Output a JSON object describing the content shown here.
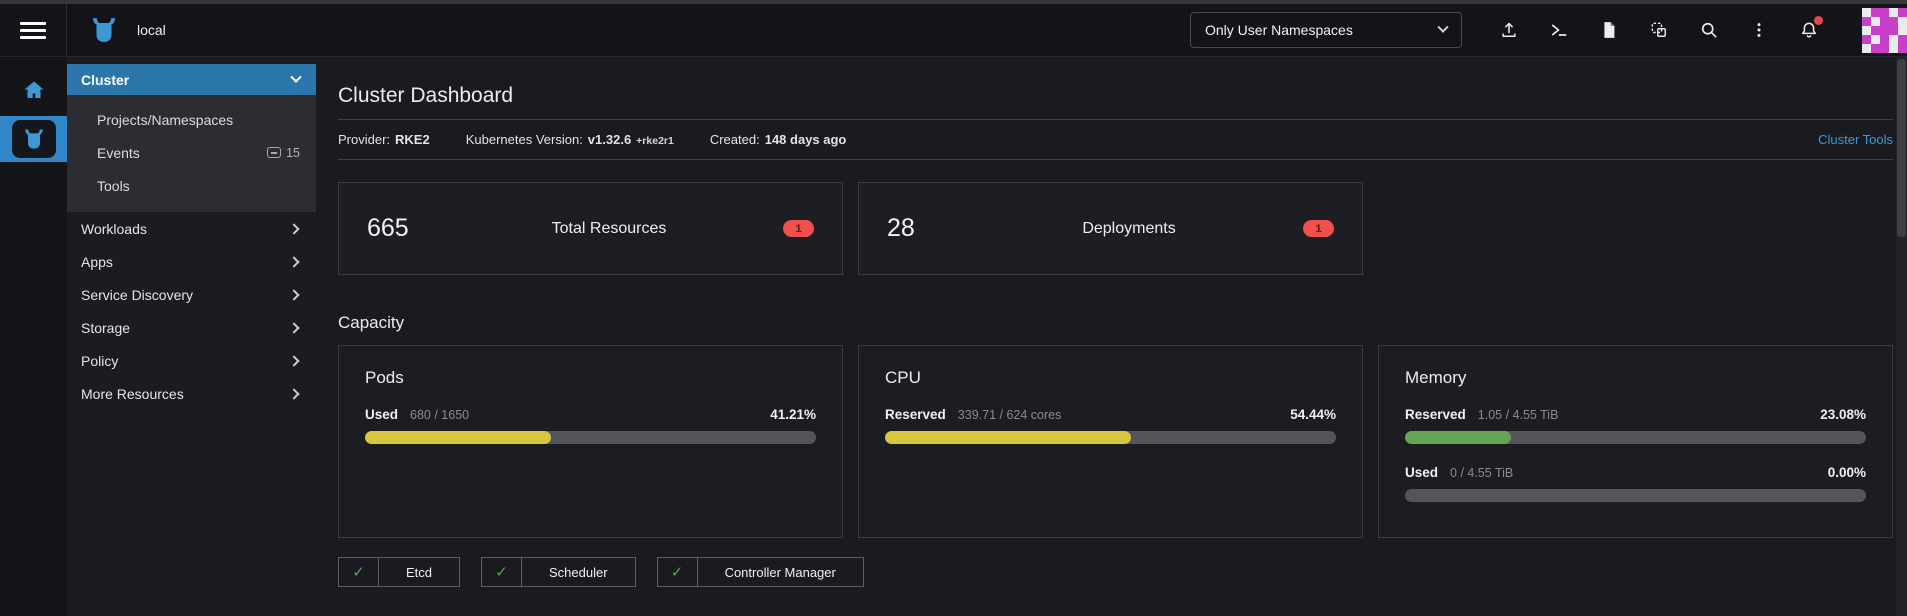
{
  "header": {
    "cluster_name": "local",
    "namespace_filter": "Only User Namespaces",
    "avatar": {
      "colors": {
        "fg": "#c93fc9",
        "bg": "#ebebeb"
      },
      "pattern": [
        [
          0,
          1,
          1,
          0,
          1
        ],
        [
          1,
          0,
          1,
          1,
          0
        ],
        [
          0,
          1,
          1,
          1,
          0
        ],
        [
          1,
          0,
          1,
          0,
          1
        ],
        [
          0,
          1,
          1,
          0,
          1
        ]
      ]
    }
  },
  "sidebar": {
    "cluster_menu": {
      "label": "Cluster",
      "children": [
        {
          "label": "Projects/Namespaces",
          "badge": ""
        },
        {
          "label": "Events",
          "badge": "15"
        },
        {
          "label": "Tools",
          "badge": ""
        }
      ]
    },
    "items": [
      "Workloads",
      "Apps",
      "Service Discovery",
      "Storage",
      "Policy",
      "More Resources"
    ]
  },
  "main": {
    "title": "Cluster Dashboard",
    "meta": {
      "provider_label": "Provider:",
      "provider_value": "RKE2",
      "k8s_label": "Kubernetes Version:",
      "k8s_value": "v1.32.6",
      "k8s_suffix": "+rke2r1",
      "created_label": "Created:",
      "created_value": "148 days ago",
      "tools_link": "Cluster Tools"
    },
    "counters": [
      {
        "value": "665",
        "label": "Total Resources",
        "badge": "1"
      },
      {
        "value": "28",
        "label": "Deployments",
        "badge": "1"
      }
    ],
    "capacity": {
      "heading": "Capacity",
      "cards": [
        {
          "title": "Pods",
          "gauges": [
            {
              "label": "Used",
              "detail": "680 / 1650",
              "percent": "41.21%",
              "fill": 41.21,
              "color": "#d8c63f"
            }
          ]
        },
        {
          "title": "CPU",
          "gauges": [
            {
              "label": "Reserved",
              "detail": "339.71 / 624 cores",
              "percent": "54.44%",
              "fill": 54.44,
              "color": "#d8c63f"
            }
          ]
        },
        {
          "title": "Memory",
          "gauges": [
            {
              "label": "Reserved",
              "detail": "1.05 / 4.55 TiB",
              "percent": "23.08%",
              "fill": 23.08,
              "color": "#67a355"
            },
            {
              "label": "Used",
              "detail": "0 / 4.55 TiB",
              "percent": "0.00%",
              "fill": 0,
              "color": "#67a355"
            }
          ]
        }
      ]
    },
    "statuses": [
      {
        "check": "✓",
        "label": "Etcd"
      },
      {
        "check": "✓",
        "label": "Scheduler"
      },
      {
        "check": "✓",
        "label": "Controller Manager"
      }
    ]
  }
}
